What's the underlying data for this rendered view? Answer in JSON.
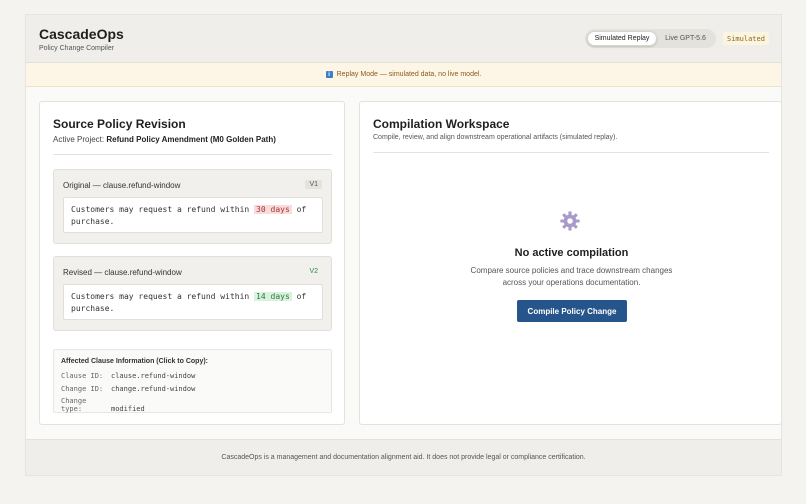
{
  "header": {
    "title": "CascadeOps",
    "subtitle": "Policy Change Compiler",
    "mode_simulated": "Simulated Replay",
    "mode_live": "Live GPT-5.6",
    "badge": "Simulated"
  },
  "banner": {
    "icon": "info-icon",
    "text": "Replay Mode — simulated data, no live model."
  },
  "source": {
    "title": "Source Policy Revision",
    "project_label": "Active Project:",
    "project_name": "Refund Policy Amendment (M0 Golden Path)",
    "original": {
      "label": "Original — clause.refund-window",
      "version": "V1",
      "text_before": "Customers may request a refund within",
      "highlight": "30 days",
      "text_after": "of purchase."
    },
    "revised": {
      "label": "Revised — clause.refund-window",
      "version": "V2",
      "text_before": "Customers may request a refund within",
      "highlight": "14 days",
      "text_after": "of purchase."
    },
    "affected": {
      "title": "Affected Clause Information (Click to Copy):",
      "clause_id_label": "Clause ID:",
      "clause_id": "clause.refund-window",
      "change_id_label": "Change ID:",
      "change_id": "change.refund-window",
      "change_type_label": "Change type:",
      "change_type": "modified"
    }
  },
  "workspace": {
    "title": "Compilation Workspace",
    "subtitle": "Compile, review, and align downstream operational artifacts (simulated replay).",
    "empty_icon": "gear-icon",
    "empty_title": "No active compilation",
    "empty_desc_line1": "Compare source policies and trace downstream changes",
    "empty_desc_line2": "across your operations documentation.",
    "compile_button": "Compile Policy Change"
  },
  "footer": {
    "text": "CascadeOps is a management and documentation alignment aid. It does not provide legal or compliance certification."
  },
  "colors": {
    "primary_button": "#26558c",
    "highlight_old": "#f8dcdc",
    "highlight_new": "#d8f2de",
    "banner_bg": "#fdf6e6"
  }
}
